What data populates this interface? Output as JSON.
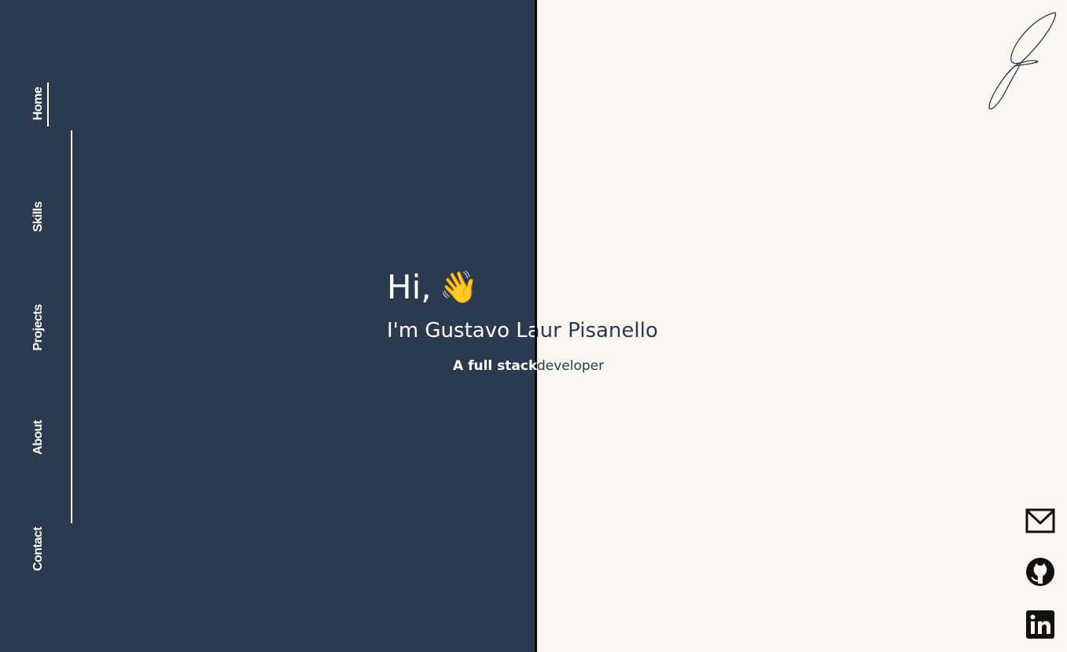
{
  "nav": {
    "items": [
      {
        "label": "Home",
        "active": true
      },
      {
        "label": "Skills",
        "active": false
      },
      {
        "label": "Projects",
        "active": false
      },
      {
        "label": "About",
        "active": false
      },
      {
        "label": "Contact",
        "active": false
      }
    ]
  },
  "hero": {
    "greeting": "Hi,",
    "wave_emoji": "👋",
    "name_line": "I'm Gustavo Laur Pisanello",
    "subtitle_start": "A full stack",
    "subtitle_end": "developer"
  },
  "social": {
    "icons": [
      "mail-icon",
      "github-icon",
      "linkedin-icon"
    ]
  },
  "colors": {
    "left_panel": "#2c3a50",
    "right_panel": "#f8f6ee",
    "divider": "#0b0b0b",
    "text_light": "#ffffff",
    "text_dark": "#2c3a50"
  }
}
